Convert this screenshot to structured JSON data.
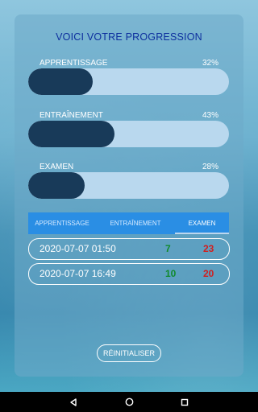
{
  "title": "VOICI VOTRE PROGRESSION",
  "stats": [
    {
      "label": "APPRENTISSAGE",
      "percent_text": "32%",
      "value": 0.32
    },
    {
      "label": "ENTRAÎNEMENT",
      "percent_text": "43%",
      "value": 0.43
    },
    {
      "label": "EXAMEN",
      "percent_text": "28%",
      "value": 0.28
    }
  ],
  "tabs": [
    {
      "label": "APPRENTISSAGE",
      "active": false
    },
    {
      "label": "ENTRAÎNEMENT",
      "active": false
    },
    {
      "label": "EXAMEN",
      "active": true
    }
  ],
  "results": [
    {
      "date": "2020-07-07 01:50",
      "correct": "7",
      "wrong": "23"
    },
    {
      "date": "2020-07-07 16:49",
      "correct": "10",
      "wrong": "20"
    }
  ],
  "reset_label": "RÉINITIALISER",
  "colors": {
    "title": "#0d2f9e",
    "bar_track": "#b9d8ee",
    "bar_fill": "#183a59",
    "tab_bar": "#2a8ee4",
    "correct": "#118a2d",
    "wrong": "#d01f1f"
  },
  "navigation": {
    "icons": [
      "back-icon",
      "home-icon",
      "recents-icon"
    ]
  }
}
